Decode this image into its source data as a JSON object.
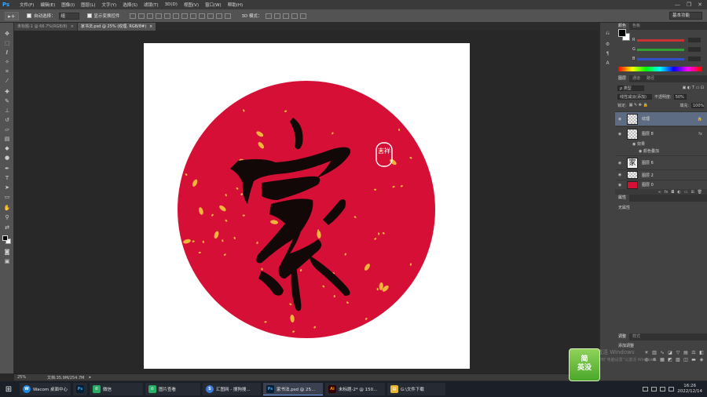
{
  "menu": {
    "logo": "Ps",
    "items": [
      "文件(F)",
      "编辑(E)",
      "图像(I)",
      "图层(L)",
      "文字(Y)",
      "选择(S)",
      "滤镜(T)",
      "3D(D)",
      "视图(V)",
      "窗口(W)",
      "帮助(H)"
    ],
    "minimize": "—",
    "restore": "❐",
    "close": "✕"
  },
  "options": {
    "tool_glyph": "▸+",
    "auto_select_label": "自动选择：",
    "auto_select_value": "组",
    "show_transform_label": "显示变换控件",
    "mode_3d_label": "3D 模式：",
    "workspace": "基本功能"
  },
  "tabs": [
    {
      "label": "未标题-1 @ 66.7%(RGB/8)",
      "close": "×"
    },
    {
      "label": "家书法.psd @ 25% (纹理, RGB/8#)",
      "close": "×"
    }
  ],
  "canvas": {
    "background": "#ffffff",
    "circle_color": "#d50f36",
    "ink_color": "#120808",
    "confetti_color": "#f2b53c",
    "calligraphy_char": "家",
    "seal_text": "吉祥"
  },
  "status": {
    "zoom": "25%",
    "doc_info": "文档:35.9M/254.7M",
    "arrow": "▸"
  },
  "color_panel": {
    "tabs": [
      "颜色",
      "色板"
    ],
    "sliders": [
      {
        "label": "R",
        "track_color": "#c83232"
      },
      {
        "label": "G",
        "track_color": "#32a032"
      },
      {
        "label": "B",
        "track_color": "#3250c8"
      }
    ]
  },
  "layers_panel": {
    "tabs": [
      "图层",
      "通道",
      "路径"
    ],
    "kind_filter": "ρ 类型",
    "blend_mode": "线性减淡(添加)",
    "opacity_label": "不透明度:",
    "opacity_value": "50%",
    "lock_label": "锁定:",
    "fill_label": "填充:",
    "fill_value": "100%",
    "layers": [
      {
        "name": "纹理",
        "selected": true,
        "right": "🔒"
      },
      {
        "name": "图层 8",
        "selected": false,
        "right": "fx"
      },
      {
        "name": "图层 6",
        "selected": false,
        "right": ""
      },
      {
        "name": "图层 2",
        "selected": false,
        "right": ""
      },
      {
        "name": "图层 0",
        "selected": false,
        "right": ""
      }
    ],
    "effects_label": "效果",
    "color_overlay_label": "颜色叠加"
  },
  "properties_panel": {
    "tab": "属性",
    "empty_text": "无属性"
  },
  "adjustments_panel": {
    "tabs": [
      "调整",
      "样式"
    ],
    "title": "添加调整"
  },
  "watermark": {
    "line1": "激活 Windows",
    "line2": "转到“电脑设置”以激活 Windows。"
  },
  "brand_badge": {
    "line1": "简",
    "line2": "英没"
  },
  "taskbar": {
    "start_glyph": "⊞",
    "items": [
      {
        "label": "Wacom 桌面中心",
        "icon": "W",
        "color": "#1e88e5"
      },
      {
        "label": "",
        "icon": "Ps",
        "color": "#001e36"
      },
      {
        "label": "微信",
        "icon": "✆",
        "color": "#2aae67"
      },
      {
        "label": "图片查看",
        "icon": "✆",
        "color": "#2aae67"
      },
      {
        "label": "汇图网 - 搜狗搜...",
        "icon": "S",
        "color": "#3c7bd8"
      },
      {
        "label": "家书法.psd @ 25...",
        "icon": "Ps",
        "color": "#001e36"
      },
      {
        "label": "未标题-2* @ 150...",
        "icon": "Ai",
        "color": "#330000"
      },
      {
        "label": "G:\\文件下载",
        "icon": "▤",
        "color": "#e7b632"
      }
    ],
    "time": "16:26",
    "date": "2022/12/14"
  }
}
